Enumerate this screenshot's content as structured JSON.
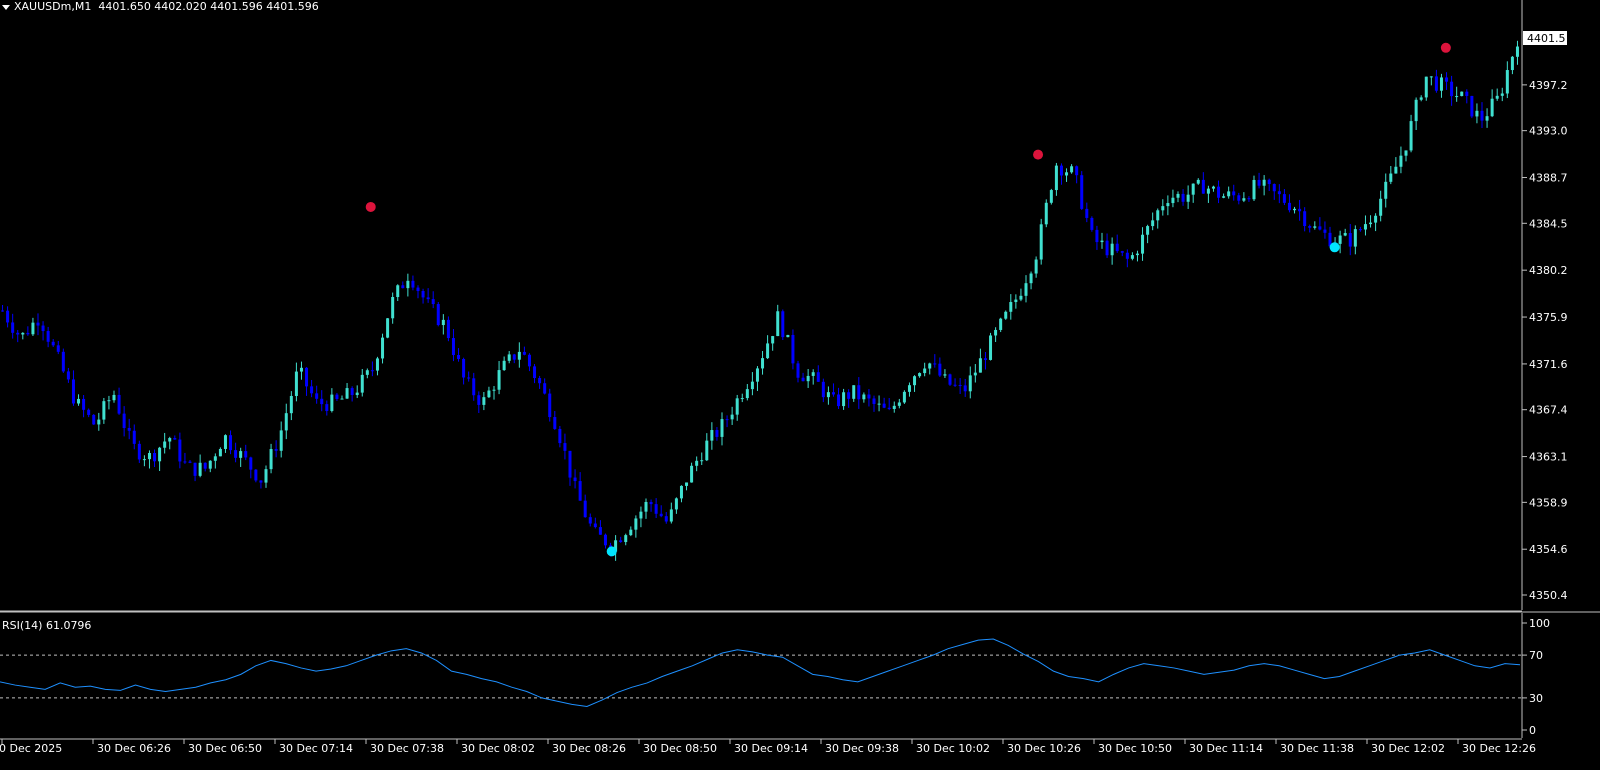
{
  "header": {
    "symbol": "XAUUSDm,M1",
    "ohlc": "4401.650 4402.020 4401.596 4401.596"
  },
  "price_axis": {
    "current_price_label": "4401.5",
    "tick_labels": [
      "4397.2",
      "4393.0",
      "4388.7",
      "4384.5",
      "4380.2",
      "4375.9",
      "4371.6",
      "4367.4",
      "4363.1",
      "4358.9",
      "4354.6",
      "4350.4"
    ],
    "tick_values": [
      4397.2,
      4393.0,
      4388.7,
      4384.5,
      4380.2,
      4375.9,
      4371.6,
      4367.4,
      4363.1,
      4358.9,
      4354.6,
      4350.4
    ]
  },
  "time_axis": {
    "labels": [
      "0 Dec 2025",
      "30 Dec 06:26",
      "30 Dec 06:50",
      "30 Dec 07:14",
      "30 Dec 07:38",
      "30 Dec 08:02",
      "30 Dec 08:26",
      "30 Dec 08:50",
      "30 Dec 09:14",
      "30 Dec 09:38",
      "30 Dec 10:02",
      "30 Dec 10:26",
      "30 Dec 10:50",
      "30 Dec 11:14",
      "30 Dec 11:38",
      "30 Dec 12:02",
      "30 Dec 12:26"
    ]
  },
  "rsi": {
    "label": "RSI(14) 61.0796",
    "levels": [
      "100",
      "70",
      "30",
      "0"
    ],
    "level_values": [
      100,
      70,
      30,
      0
    ],
    "overbought": 70,
    "oversold": 30
  },
  "colors": {
    "background": "#000000",
    "bull_candle": "#40e0d0",
    "bear_candle": "#0000ff",
    "sell_signal": "#dc143c",
    "buy_signal": "#00e5ff",
    "rsi_line": "#1e90ff",
    "axis": "#c0c0c0"
  },
  "chart_data": {
    "type": "candlestick",
    "series_anchor_prices": [
      4376.5,
      4374,
      4376,
      4372,
      4368,
      4366,
      4369,
      4364,
      4363,
      4365,
      4362,
      4362,
      4365,
      4363,
      4361,
      4365,
      4371,
      4368,
      4368,
      4369,
      4371,
      4377,
      4380,
      4377,
      4375,
      4370,
      4368,
      4371,
      4373,
      4370,
      4366,
      4360,
      4356,
      4355,
      4357,
      4359,
      4357,
      4361,
      4364,
      4366,
      4369,
      4372,
      4376,
      4371,
      4370,
      4368,
      4369,
      4368,
      4367,
      4370,
      4372,
      4370,
      4369,
      4372,
      4375,
      4378,
      4382,
      4390,
      4389,
      4383,
      4382,
      4381,
      4384,
      4387,
      4387,
      4388,
      4387,
      4387,
      4388,
      4387,
      4386,
      4384,
      4383,
      4383,
      4385,
      4388,
      4392,
      4398,
      4397,
      4396,
      4394,
      4396,
      4401.5
    ],
    "signals": [
      {
        "type": "sell",
        "price": 4386.0,
        "index": 20
      },
      {
        "type": "buy",
        "price": 4354.4,
        "index": 33
      },
      {
        "type": "sell",
        "price": 4390.8,
        "index": 56
      },
      {
        "type": "buy",
        "price": 4382.3,
        "index": 72
      },
      {
        "type": "sell",
        "price": 4400.6,
        "index": 78
      }
    ],
    "rsi_values": [
      45,
      42,
      40,
      38,
      44,
      40,
      41,
      38,
      37,
      42,
      38,
      36,
      38,
      40,
      44,
      47,
      52,
      60,
      65,
      62,
      58,
      55,
      57,
      60,
      65,
      70,
      74,
      76,
      72,
      65,
      55,
      52,
      48,
      45,
      40,
      36,
      30,
      27,
      24,
      22,
      28,
      35,
      40,
      44,
      50,
      55,
      60,
      66,
      72,
      75,
      73,
      70,
      68,
      60,
      52,
      50,
      47,
      45,
      50,
      55,
      60,
      65,
      70,
      76,
      80,
      84,
      85,
      79,
      71,
      64,
      55,
      50,
      48,
      45,
      52,
      58,
      62,
      60,
      58,
      55,
      52,
      54,
      56,
      60,
      62,
      60,
      56,
      52,
      48,
      50,
      55,
      60,
      65,
      70,
      72,
      75,
      70,
      65,
      60,
      58,
      62,
      61
    ]
  }
}
